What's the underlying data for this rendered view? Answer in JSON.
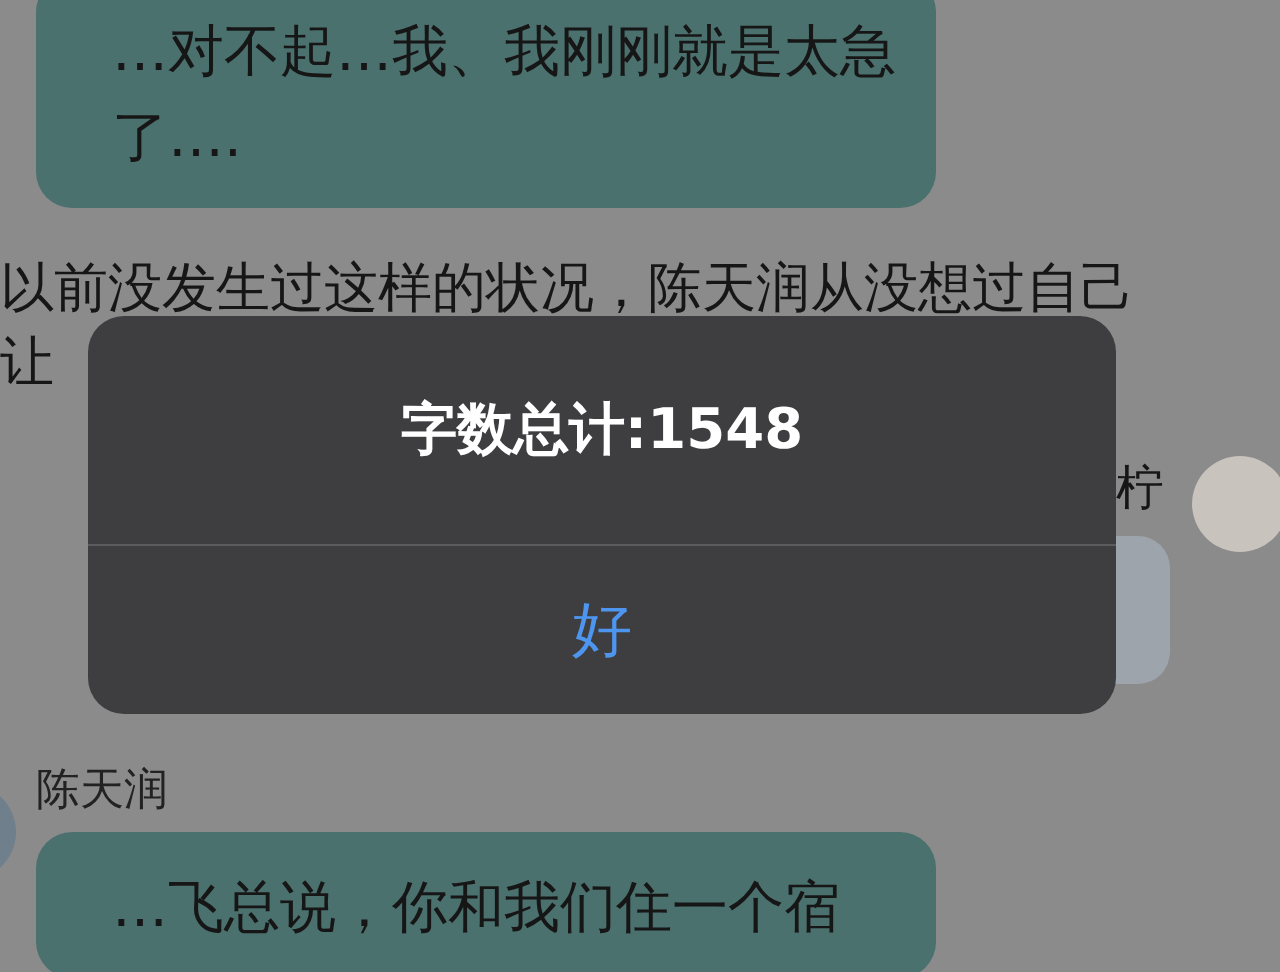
{
  "messages": [
    {
      "kind": "left",
      "text": "…对不起…我、我刚刚就是太急了…."
    },
    {
      "kind": "narration",
      "lines": [
        "以前没发生过这样的状况，陈天润从没想过自己",
        "让"
      ]
    },
    {
      "kind": "right",
      "sender": "柠"
    },
    {
      "kind": "left",
      "sender": "陈天润",
      "text": "…飞总说，你和我们住一个宿"
    }
  ],
  "alert": {
    "title": "字数总计:1548",
    "button": "好"
  }
}
